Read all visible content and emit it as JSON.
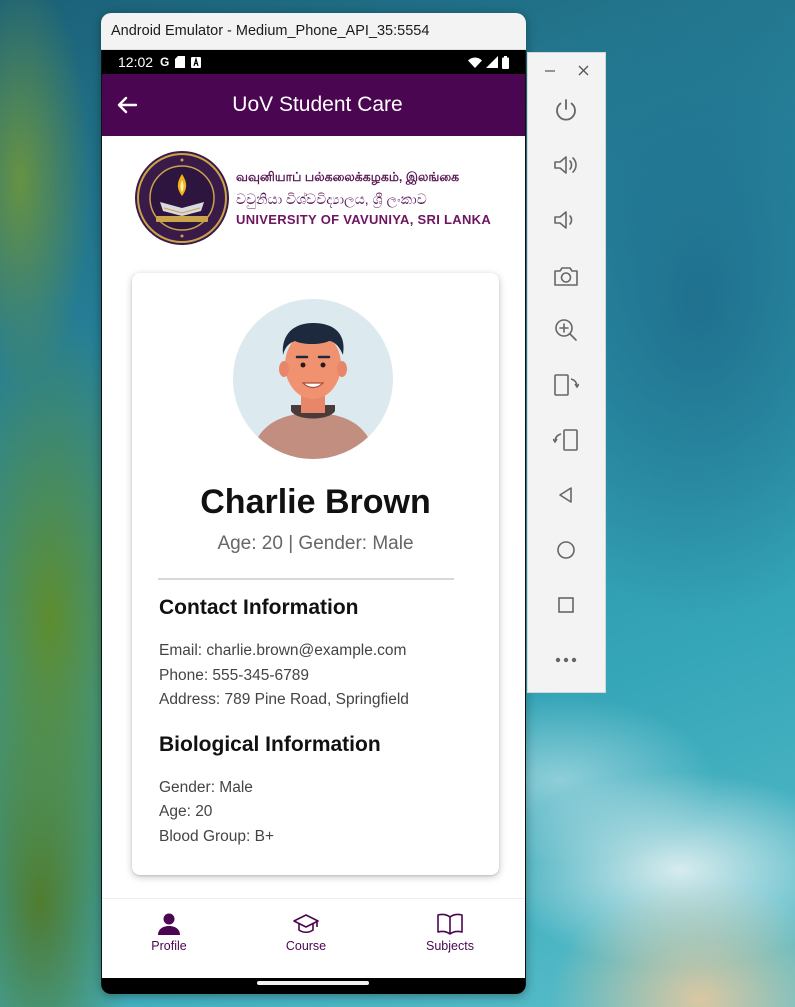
{
  "window": {
    "title": "Android Emulator - Medium_Phone_API_35:5554"
  },
  "status_bar": {
    "time": "12:02",
    "left_icons": [
      "google-icon",
      "sd-card-icon",
      "accessibility-icon"
    ],
    "right_icons": [
      "wifi-icon",
      "cell-signal-icon",
      "battery-icon"
    ]
  },
  "app_bar": {
    "title": "UoV Student Care"
  },
  "logo": {
    "line1": "வவுனியாப் பல்கலைக்கழகம், இலங்கை",
    "line2": "වවුනියා විශ්වවිද්‍යාලය, ශ්‍රී ලංකාව",
    "line3": "UNIVERSITY OF VAVUNIYA, SRI LANKA"
  },
  "profile": {
    "name": "Charlie Brown",
    "meta": "Age: 20 | Gender: Male"
  },
  "contact": {
    "title": "Contact Information",
    "email": "Email: charlie.brown@example.com",
    "phone": "Phone: 555-345-6789",
    "address": "Address: 789 Pine Road, Springfield"
  },
  "biological": {
    "title": "Biological Information",
    "gender": "Gender: Male",
    "age": "Age: 20",
    "blood_group": "Blood Group: B+"
  },
  "bottom_nav": {
    "items": [
      {
        "label": "Profile",
        "icon": "person-icon",
        "active": true
      },
      {
        "label": "Course",
        "icon": "graduation-cap-icon",
        "active": false
      },
      {
        "label": "Subjects",
        "icon": "book-icon",
        "active": false
      }
    ]
  },
  "emulator_toolbar": {
    "window_controls": [
      "minimize-icon",
      "close-icon"
    ],
    "buttons": [
      "power-icon",
      "volume-up-icon",
      "volume-down-icon",
      "camera-icon",
      "zoom-in-icon",
      "rotate-left-icon",
      "rotate-right-icon",
      "back-icon",
      "home-icon",
      "overview-icon",
      "more-icon"
    ]
  },
  "colors": {
    "app_bar": "#4a0650",
    "accent": "#4a0650",
    "logo_text": "#6d1560",
    "status_bar": "#000000"
  }
}
